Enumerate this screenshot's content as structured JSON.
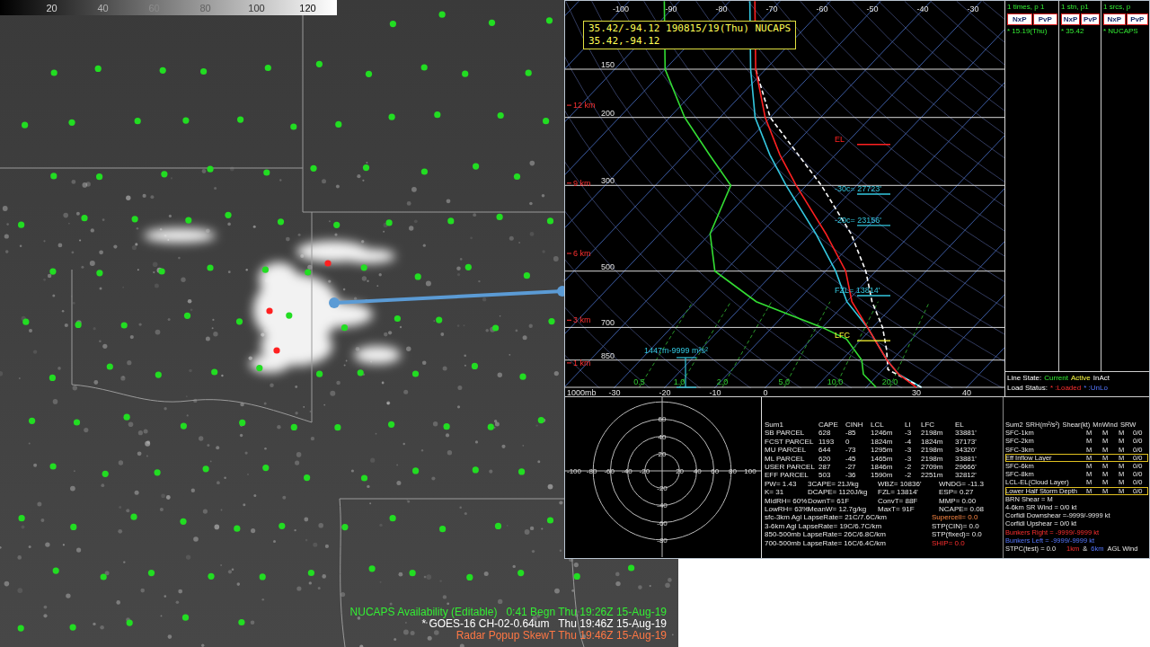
{
  "colorbar": {
    "ticks": [
      "20",
      "40",
      "60",
      "80",
      "100",
      "120"
    ]
  },
  "map": {
    "point_color": "#22dd22",
    "highlighted_points": [
      {
        "color": "#ff2020"
      },
      {
        "color": "#ff2020"
      },
      {
        "color": "#ff2020"
      }
    ],
    "line_color": "#5b9bd5"
  },
  "status_lines": [
    {
      "text": "NUCAPS Availability (Editable)   0:41 Begn Thu 19:26Z 15-Aug-19",
      "color": "#33ee33"
    },
    {
      "text": "* GOES-16 CH-02-0.64um   Thu 19:46Z 15-Aug-19",
      "color": "#ffffff"
    },
    {
      "text": "Radar Popup SkewT Thu 19:46Z 15-Aug-19",
      "color": "#ff7744"
    }
  ],
  "skewt": {
    "header": [
      "35.42/-94.12 190815/19(Thu) NUCAPS",
      "35.42,-94.12"
    ],
    "top_ticks": [
      "-100",
      "-90",
      "-80",
      "-70",
      "-60",
      "-50",
      "-40",
      "-30"
    ],
    "bottom_ticks": [
      "-30",
      "-20",
      "-10",
      "0",
      "30",
      "40"
    ],
    "pressure_labels": [
      "150",
      "200",
      "300",
      "500",
      "700",
      "850"
    ],
    "surface_label": "1000mb",
    "height_labels": [
      {
        "label": "12 km",
        "p": 186
      },
      {
        "label": "9 km",
        "p": 296
      },
      {
        "label": "6 km",
        "p": 450
      },
      {
        "label": "3 km",
        "p": 670
      },
      {
        "label": "1 km",
        "p": 865
      }
    ],
    "mixing_ratio_labels": [
      "0.5",
      "1.0",
      "2.0",
      "5.0",
      "10.0",
      "20.0"
    ],
    "series": [
      {
        "name": "dewpoint",
        "color": "#33dd33",
        "dashed": false,
        "points": [
          [
            1000,
            22
          ],
          [
            925,
            17
          ],
          [
            850,
            14
          ],
          [
            750,
            7
          ],
          [
            700,
            0
          ],
          [
            600,
            -18
          ],
          [
            500,
            -32
          ],
          [
            400,
            -40
          ],
          [
            300,
            -45
          ],
          [
            250,
            -55
          ],
          [
            200,
            -67
          ],
          [
            150,
            -80
          ],
          [
            100,
            -93
          ]
        ]
      },
      {
        "name": "virtual-temperature",
        "color": "#33c8e0",
        "dashed": false,
        "points": [
          [
            1000,
            31
          ],
          [
            925,
            24
          ],
          [
            850,
            19
          ],
          [
            700,
            9
          ],
          [
            600,
            0
          ],
          [
            500,
            -8
          ],
          [
            400,
            -19
          ],
          [
            300,
            -34
          ],
          [
            250,
            -43
          ],
          [
            200,
            -53
          ],
          [
            150,
            -63
          ],
          [
            100,
            -76
          ]
        ]
      },
      {
        "name": "parcel",
        "color": "#ffffff",
        "dashed": true,
        "points": [
          [
            1000,
            31
          ],
          [
            900,
            21
          ],
          [
            800,
            17
          ],
          [
            700,
            12
          ],
          [
            600,
            5
          ],
          [
            500,
            -2
          ],
          [
            400,
            -12
          ],
          [
            300,
            -27
          ],
          [
            200,
            -50
          ],
          [
            150,
            -62
          ]
        ]
      },
      {
        "name": "temperature",
        "color": "#ff2020",
        "dashed": false,
        "points": [
          [
            1000,
            30
          ],
          [
            925,
            24
          ],
          [
            850,
            19
          ],
          [
            700,
            9
          ],
          [
            600,
            1
          ],
          [
            500,
            -6
          ],
          [
            400,
            -17
          ],
          [
            300,
            -32
          ],
          [
            250,
            -41
          ],
          [
            200,
            -51
          ],
          [
            150,
            -62
          ],
          [
            100,
            -75
          ]
        ]
      }
    ],
    "annotations": [
      {
        "label": "EL",
        "color": "#ff2020",
        "p": 235
      },
      {
        "label": "-30c= 27723'",
        "color": "#33c8e0",
        "p": 316
      },
      {
        "label": "-20c= 23156'",
        "color": "#33c8e0",
        "p": 381
      },
      {
        "label": "FZL= 13814'",
        "color": "#33c8e0",
        "p": 579
      },
      {
        "label": "LFC",
        "color": "#ffff33",
        "p": 757
      }
    ],
    "helicity_label": "1447m-9999 m²s²"
  },
  "sidebar": {
    "header": [
      "1 times, p 1",
      "1 stn, p1",
      "1 srcs, p"
    ],
    "columns": [
      {
        "buttons": [
          "NxP",
          "PvP"
        ],
        "value": "* 15.19(Thu)"
      },
      {
        "buttons": [
          "NxP",
          "PvP"
        ],
        "value": "* 35.42"
      },
      {
        "buttons": [
          "NxP",
          "PvP"
        ],
        "value": "* NUCAPS"
      }
    ],
    "line_state": {
      "label": "Line State:",
      "items": [
        {
          "text": "Current",
          "color": "#33ee33"
        },
        {
          "text": "Active",
          "color": "#ffff44"
        },
        {
          "text": "InAct",
          "color": "#ffffff"
        }
      ]
    },
    "load_status": {
      "label": "Load Status:",
      "items": [
        {
          "text": "* :Loaded",
          "color": "#ff3030"
        },
        {
          "text": "* :UnLo",
          "color": "#5577ff"
        }
      ]
    }
  },
  "hodograph": {
    "x_labels": [
      "-100",
      "-80",
      "-60",
      "-40",
      "-20",
      "20",
      "40",
      "60",
      "80",
      "100"
    ],
    "y_labels": [
      "60",
      "40",
      "20",
      "-20",
      "-40",
      "-60",
      "-80"
    ]
  },
  "parcel_table": {
    "columns": [
      "Sum1",
      "CAPE",
      "CINH",
      "LCL",
      "LI",
      "LFC",
      "EL"
    ],
    "rows": [
      [
        "SB PARCEL",
        "628",
        "-85",
        "1246m",
        "-3",
        "2198m",
        "33881'"
      ],
      [
        "FCST PARCEL",
        "1193",
        "0",
        "1824m",
        "-4",
        "1824m",
        "37173'"
      ],
      [
        "MU PARCEL",
        "644",
        "-73",
        "1295m",
        "-3",
        "2198m",
        "34320'"
      ],
      [
        "ML PARCEL",
        "620",
        "-45",
        "1465m",
        "-3",
        "2198m",
        "33881'"
      ],
      [
        "USER PARCEL",
        "287",
        "-27",
        "1846m",
        "-2",
        "2709m",
        "29666'"
      ],
      [
        "EFF PARCEL",
        "503",
        "-36",
        "1590m",
        "-2",
        "2251m",
        "32812'"
      ]
    ]
  },
  "indices": [
    [
      "PW= 1.43",
      "3CAPE= 21J/kg",
      "WBZ= 10836'",
      "WNDG= -11.3"
    ],
    [
      "K= 31",
      "DCAPE= 1120J/kg",
      "FZL= 13814'",
      "ESP= 0.27"
    ],
    [
      "MidRH= 60%",
      "DownT= 61F",
      "ConvT= 88F",
      "MMP= 0.00"
    ],
    [
      "LowRH= 63%",
      "MeanW= 12.7g/kg",
      "MaxT= 91F",
      "NCAPE= 0.08"
    ]
  ],
  "lapse_rates": [
    [
      {
        "text": "sfc-3km Agl LapseRate= 21C/7.6C/km",
        "color": "#e8e8e8"
      },
      {
        "text": "Supercell= 0.0",
        "color": "#ff8844"
      }
    ],
    [
      {
        "text": "3-6km Agl LapseRate= 19C/6.7C/km",
        "color": "#e8e8e8"
      },
      {
        "text": "STP(CIN)= 0.0",
        "color": "#e8e8e8"
      }
    ],
    [
      {
        "text": "850-500mb LapseRate= 26C/6.8C/km",
        "color": "#e8e8e8"
      },
      {
        "text": "STP(fixed)= 0.0",
        "color": "#e8e8e8"
      }
    ],
    [
      {
        "text": "700-500mb LapseRate= 16C/6.4C/km",
        "color": "#e8e8e8"
      },
      {
        "text": "SHIP= 0.0",
        "color": "#ff3030"
      }
    ]
  ],
  "shear_table": {
    "columns": [
      "Sum2",
      "SRH(m²/s²)",
      "Shear(kt)",
      "MnWind",
      "SRW"
    ],
    "rows": [
      {
        "label": "SFC-1km",
        "values": [
          "M",
          "M",
          "M",
          "0/0"
        ],
        "highlighted": false
      },
      {
        "label": "SFC-2km",
        "values": [
          "M",
          "M",
          "M",
          "0/0"
        ],
        "highlighted": false
      },
      {
        "label": "SFC-3km",
        "values": [
          "M",
          "M",
          "M",
          "0/0"
        ],
        "highlighted": false
      },
      {
        "label": "Eff Inflow Layer",
        "values": [
          "M",
          "M",
          "M",
          "0/0"
        ],
        "highlighted": true
      },
      {
        "label": "SFC-6km",
        "values": [
          "M",
          "M",
          "M",
          "0/0"
        ],
        "highlighted": false
      },
      {
        "label": "SFC-8km",
        "values": [
          "M",
          "M",
          "M",
          "0/0"
        ],
        "highlighted": false
      },
      {
        "label": "LCL-EL(Cloud Layer)",
        "values": [
          "M",
          "M",
          "M",
          "0/0"
        ],
        "highlighted": false
      },
      {
        "label": "Lower Half Storm Depth",
        "values": [
          "M",
          "M",
          "M",
          "0/0"
        ],
        "highlighted": true
      }
    ]
  },
  "shear_summary": [
    [
      {
        "text": "BRN Shear = M",
        "color": "#e8e8e8"
      }
    ],
    [
      {
        "text": "4-6km SR Wind = 0/0 kt",
        "color": "#e8e8e8"
      }
    ],
    [
      {
        "text": "Corfidi Downshear =-9999/-9999 kt",
        "color": "#e8e8e8"
      }
    ],
    [
      {
        "text": "Corfidi Upshear = 0/0 kt",
        "color": "#e8e8e8"
      }
    ],
    [
      {
        "text": "Bunkers Right = -9999/-9999 kt",
        "color": "#ff3030"
      }
    ],
    [
      {
        "text": "Bunkers Left = -9999/-9999 kt",
        "color": "#5577ff"
      }
    ],
    [
      {
        "text": "STPC(test) = 0.0",
        "color": "#e8e8e8"
      },
      {
        "text": "1km",
        "color": "#ff3030"
      },
      {
        "text": "&",
        "color": "#e8e8e8"
      },
      {
        "text": "6km",
        "color": "#5577ff"
      },
      {
        "text": "AGL Wind",
        "color": "#e8e8e8"
      }
    ]
  ]
}
